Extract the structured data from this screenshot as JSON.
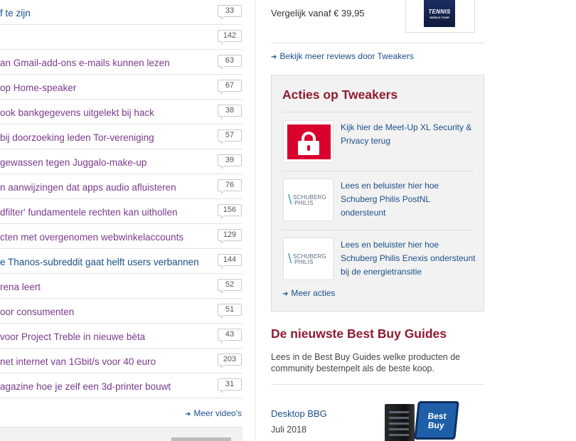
{
  "news": {
    "items": [
      {
        "title": "f te zijn",
        "count": "33",
        "visited": false
      },
      {
        "title": "",
        "count": "142",
        "visited": false
      },
      {
        "title": "an Gmail-add-ons e-mails kunnen lezen",
        "count": "63",
        "visited": true
      },
      {
        "title": "op Home-speaker",
        "count": "67",
        "visited": true
      },
      {
        "title": "ook bankgegevens uitgelekt bij hack",
        "count": "38",
        "visited": true
      },
      {
        "title": "bij doorzoeking leden Tor-vereniging",
        "count": "57",
        "visited": true
      },
      {
        "title": "gewassen tegen Juggalo-make-up",
        "count": "39",
        "visited": true
      },
      {
        "title": "n aanwijzingen dat apps audio afluisteren",
        "count": "76",
        "visited": true
      },
      {
        "title": "dfilter' fundamentele rechten kan uithollen",
        "count": "156",
        "visited": true
      },
      {
        "title": "cten met overgenomen webwinkelaccounts",
        "count": "129",
        "visited": true
      },
      {
        "title": "e Thanos-subreddit gaat helft users verbannen",
        "count": "144",
        "visited": false
      },
      {
        "title": "rena leert",
        "count": "52",
        "visited": true
      },
      {
        "title": "oor consumenten",
        "count": "51",
        "visited": true
      },
      {
        "title": "voor Project Treble in nieuwe bèta",
        "count": "43",
        "visited": true
      },
      {
        "title": "net internet van 1Gbit/s voor 40 euro",
        "count": "203",
        "visited": true
      },
      {
        "title": "agazine hoe je zelf een 3d-printer bouwt",
        "count": "31",
        "visited": true
      }
    ],
    "more_videos": "Meer video's"
  },
  "review": {
    "price": "Vergelijk vanaf € 39,95",
    "cover_title": "TENNIS",
    "cover_subtitle": "WORLD TOUR",
    "more_reviews": "Bekijk meer reviews door Tweakers"
  },
  "acties": {
    "title": "Acties op Tweakers",
    "items": [
      {
        "text": "Kijk hier de Meet-Up XL Security & Privacy terug",
        "icon": "lock-icon"
      },
      {
        "text": "Lees en beluister hier hoe Schuberg Philis PostNL ondersteunt",
        "icon": "schuberg-philis-logo"
      },
      {
        "text": "Lees en beluister hier hoe Schuberg Philis Enexis ondersteunt bij de energietransitie",
        "icon": "schuberg-philis-logo"
      }
    ],
    "logo_line1": "SCHUBERG",
    "logo_line2": "PHILIS",
    "more": "Meer acties"
  },
  "bbg": {
    "title": "De nieuwste Best Buy Guides",
    "description": "Lees in de Best Buy Guides welke producten de community bestempelt als de beste koop.",
    "item_name": "Desktop BBG",
    "item_date": "Juli 2018",
    "badge_line1": "Best",
    "badge_line2": "Buy"
  },
  "colors": {
    "link": "#1a4f8a",
    "visited": "#7a3b8c",
    "heading": "#8e1a33",
    "promo_red": "#d9002e"
  }
}
